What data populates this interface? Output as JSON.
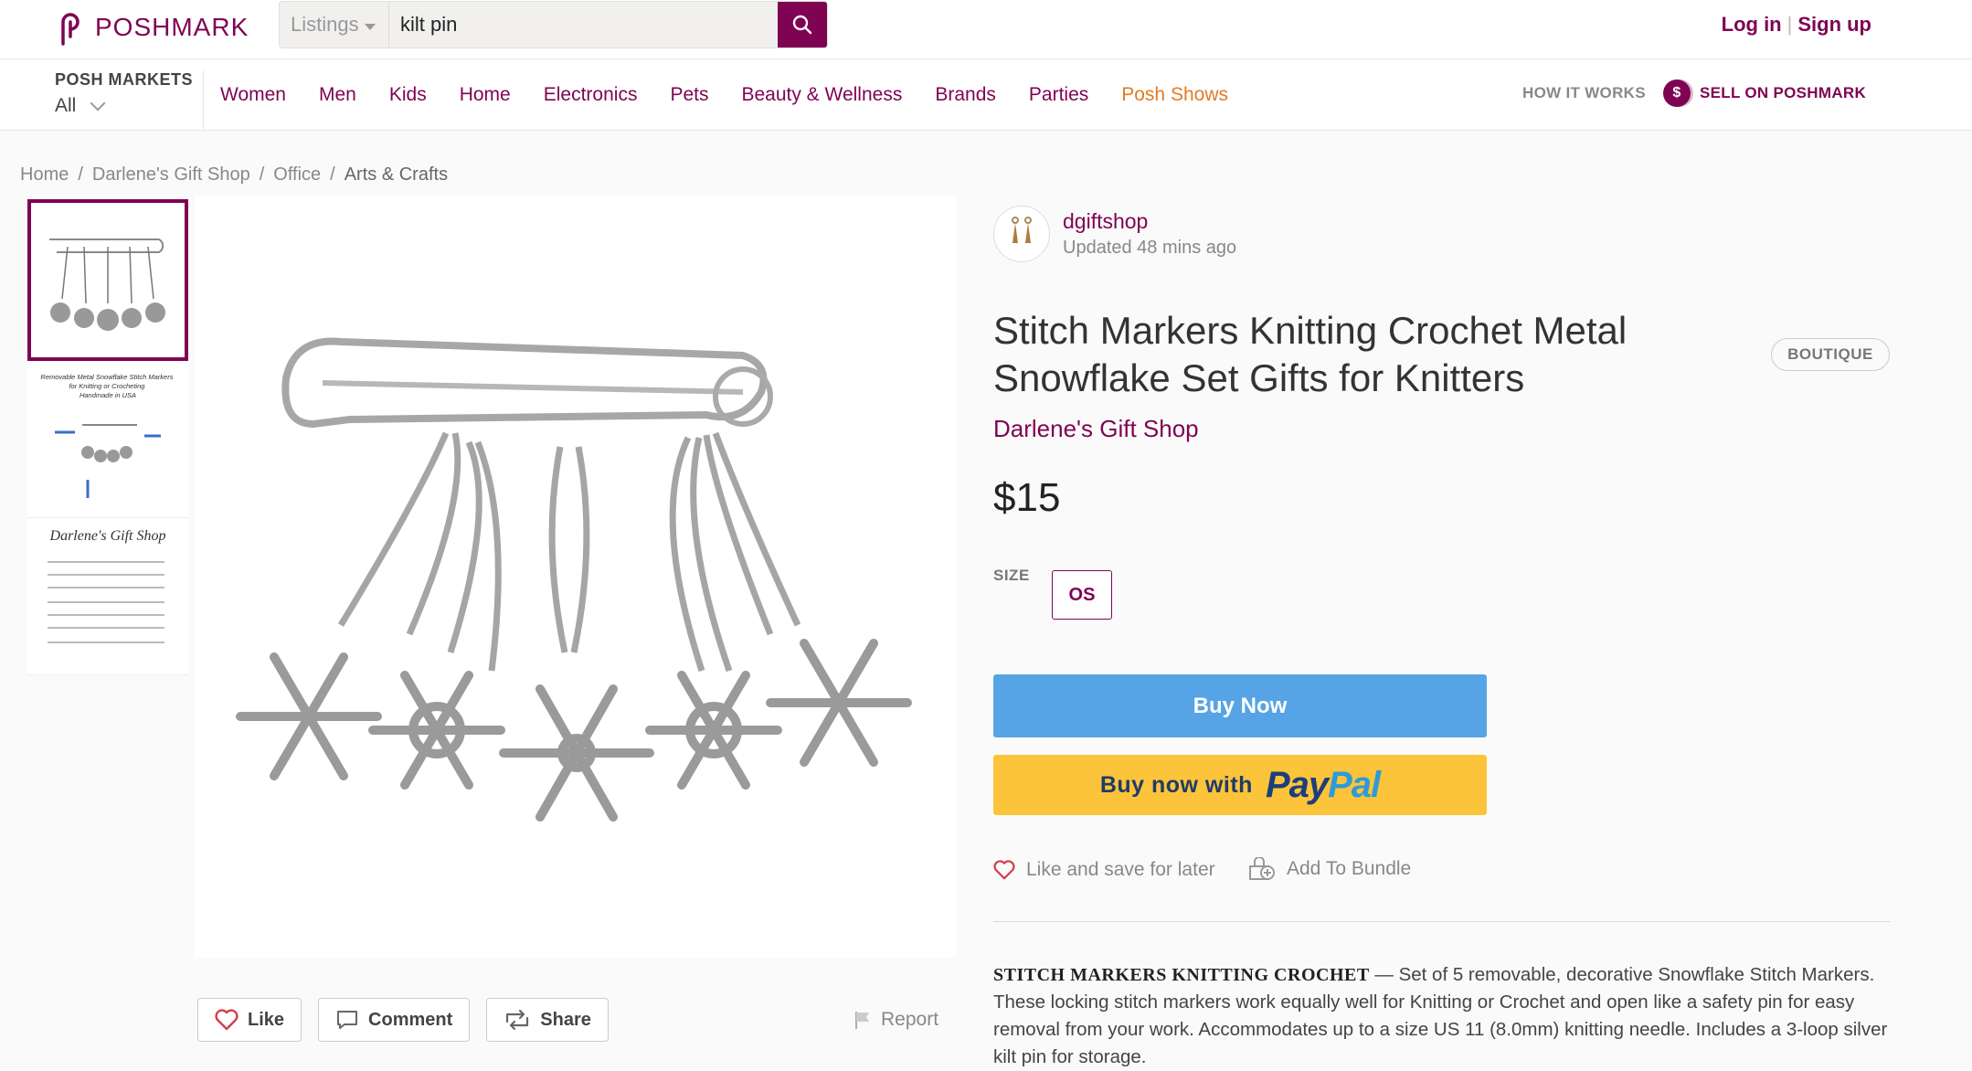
{
  "header": {
    "logo_text": "POSHMARK",
    "search_scope": "Listings",
    "search_value": "kilt pin",
    "login_label": "Log in",
    "signup_label": "Sign up"
  },
  "nav": {
    "markets_title": "POSH MARKETS",
    "markets_value": "All",
    "items": [
      "Women",
      "Men",
      "Kids",
      "Home",
      "Electronics",
      "Pets",
      "Beauty & Wellness",
      "Brands",
      "Parties",
      "Posh Shows"
    ],
    "how_it_works": "HOW IT WORKS",
    "sell_label": "SELL ON POSHMARK",
    "sell_coin": "$"
  },
  "breadcrumb": [
    "Home",
    "Darlene's Gift Shop",
    "Office",
    "Arts & Crafts"
  ],
  "gallery": {
    "thumb2_title": "Removable Metal Snowflake Stitch Markers for Knitting or Crocheting Handmade in USA",
    "thumb3_title": "Darlene's Gift Shop"
  },
  "image_actions": {
    "like": "Like",
    "comment": "Comment",
    "share": "Share",
    "report": "Report"
  },
  "seller": {
    "username": "dgiftshop",
    "updated": "Updated 48 mins ago"
  },
  "listing": {
    "title": "Stitch Markers Knitting Crochet Metal Snowflake Set Gifts for Knitters",
    "badge": "BOUTIQUE",
    "brand": "Darlene's Gift Shop",
    "price": "$15",
    "size_label": "SIZE",
    "size_value": "OS",
    "buy_now": "Buy Now",
    "paypal_prefix": "Buy now with",
    "paypal_pay": "Pay",
    "paypal_pal": "Pal",
    "like_save": "Like and save for later",
    "add_bundle": "Add To Bundle",
    "desc_head": "STITCH MARKERS KNITTING CROCHET",
    "desc_body": " — Set of 5 removable, decorative Snowflake Stitch Markers. These locking stitch markers work equally well for Knitting or Crochet and open like a safety pin for easy removal from your work. Accommodates up to a size US 11 (8.0mm) knitting needle. Includes a 3-loop silver kilt pin for storage."
  },
  "colors": {
    "brand": "#7f0353",
    "accent_orange": "#e07b24",
    "buy_now_blue": "#56a4e6",
    "paypal_yellow": "#fbc43a"
  }
}
